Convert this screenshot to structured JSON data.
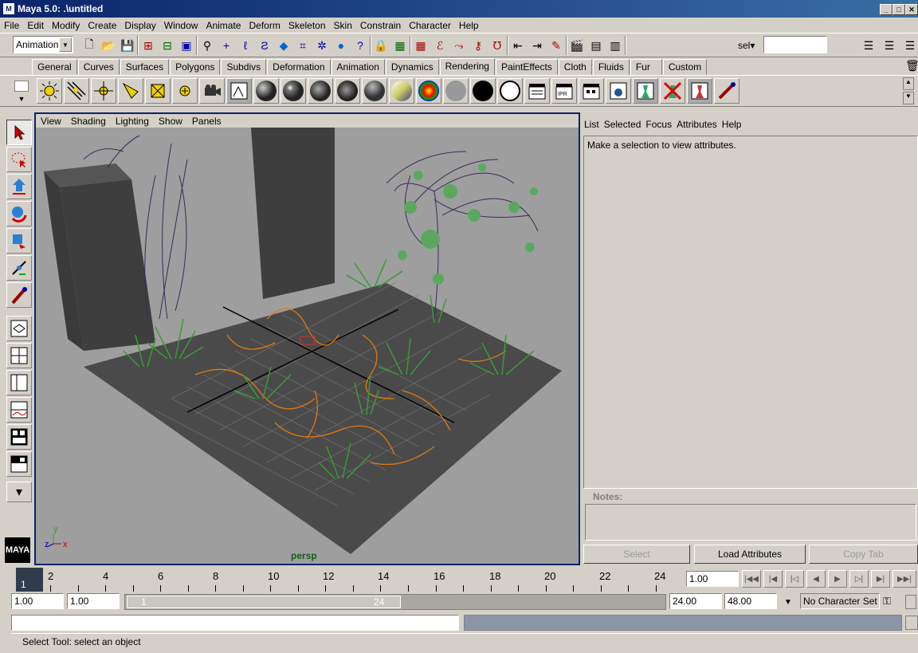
{
  "window": {
    "title": "Maya 5.0: .\\untitled",
    "minimize": "_",
    "maximize": "□",
    "close": "✕"
  },
  "menus": [
    "File",
    "Edit",
    "Modify",
    "Create",
    "Display",
    "Window",
    "Animate",
    "Deform",
    "Skeleton",
    "Skin",
    "Constrain",
    "Character",
    "Help"
  ],
  "status_line": {
    "menu_set": "Animation",
    "sel_label": "sel▾",
    "sel_value": ""
  },
  "shelf_tabs": [
    "General",
    "Curves",
    "Surfaces",
    "Polygons",
    "Subdivs",
    "Deformation",
    "Animation",
    "Dynamics",
    "Rendering",
    "PaintEffects",
    "Cloth",
    "Fluids",
    "Fur",
    "Custom"
  ],
  "active_shelf_tab": "Rendering",
  "viewport": {
    "menus": [
      "View",
      "Shading",
      "Lighting",
      "Show",
      "Panels"
    ],
    "camera_label": "persp",
    "axis_y": "y",
    "axis_z": "z",
    "axis_x": "x"
  },
  "attribute_editor": {
    "menus": [
      "List",
      "Selected",
      "Focus",
      "Attributes",
      "Help"
    ],
    "message": "Make a selection to view attributes.",
    "notes_label": "Notes:",
    "buttons": {
      "select": "Select",
      "load": "Load Attributes",
      "copy": "Copy Tab"
    }
  },
  "time_slider": {
    "current_frame": "1",
    "ticks": [
      "2",
      "4",
      "6",
      "8",
      "10",
      "12",
      "14",
      "16",
      "18",
      "20",
      "22",
      "24"
    ],
    "current_time": "1.00"
  },
  "range_slider": {
    "start_time": "1.00",
    "playback_start": "1.00",
    "range_left": "1",
    "range_right": "24",
    "playback_end": "24.00",
    "end_time": "48.00",
    "character_set": "No Character Set"
  },
  "help_line": "Select Tool: select an object",
  "colors": {
    "title_bg": "#0a246a",
    "viewport_bg": "#9e9e9e",
    "grid_curve": "#e07a10",
    "grass": "#3a9a3a"
  }
}
